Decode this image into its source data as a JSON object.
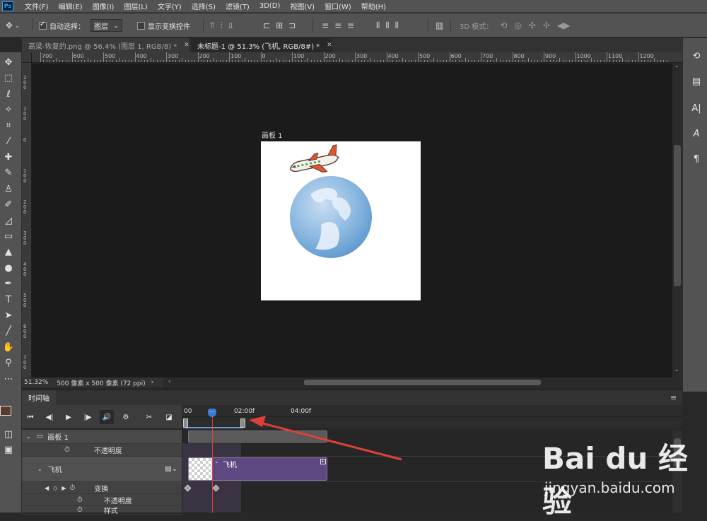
{
  "app": {
    "logo_text": "Ps"
  },
  "menu": [
    "文件(F)",
    "编辑(E)",
    "图像(I)",
    "图层(L)",
    "文字(Y)",
    "选择(S)",
    "滤镜(T)",
    "3D(D)",
    "视图(V)",
    "窗口(W)",
    "帮助(H)"
  ],
  "options": {
    "auto_select_label": "自动选择：",
    "auto_select_checked": true,
    "layer_dropdown": "图层",
    "show_transform_label": "显示变换控件",
    "show_transform_checked": false,
    "mode_3d_label": "3D 模式："
  },
  "tabs": [
    {
      "label": "高梁-恢复的.png @ 56.4% (图层 1, RGB/8) *",
      "active": false
    },
    {
      "label": "未标题-1 @ 51.3% (飞机, RGB/8#) *",
      "active": true
    }
  ],
  "ruler_top": [
    "700",
    "600",
    "500",
    "400",
    "300",
    "200",
    "100",
    "0",
    "100",
    "200",
    "300",
    "400",
    "500",
    "600",
    "700",
    "800",
    "900",
    "1000",
    "1100",
    "1200"
  ],
  "ruler_left": [
    "2\n0\n0",
    "1\n0\n0",
    "0",
    "1\n0\n0",
    "2\n0\n0",
    "3\n0\n0",
    "4\n0\n0",
    "5\n0\n0",
    "6\n0\n0",
    "7\n0\n0"
  ],
  "artboard": {
    "label": "画板 1"
  },
  "status": {
    "zoom": "51.32%",
    "doc_info": "500 像素 x 500 像素 (72 ppi)"
  },
  "timeline": {
    "tab_label": "时间轴",
    "ruler_labels": [
      "00",
      "02:00f",
      "04:00f"
    ],
    "playhead_label": "···",
    "rows": {
      "artboard_group": "画板 1",
      "artboard_opacity": "不透明度",
      "layer_name": "飞机",
      "transform": "变换",
      "opacity": "不透明度",
      "style": "样式"
    },
    "clip_label": "飞机"
  },
  "watermark": {
    "logo": "Bai du 经验",
    "url": "jingyan.baidu.com"
  },
  "colors": {
    "accent": "#31a8ff",
    "playhead": "#e0403a",
    "clip": "#5d4882",
    "arrow": "#e0403a",
    "foreground_swatch": "#5a3a2e"
  }
}
